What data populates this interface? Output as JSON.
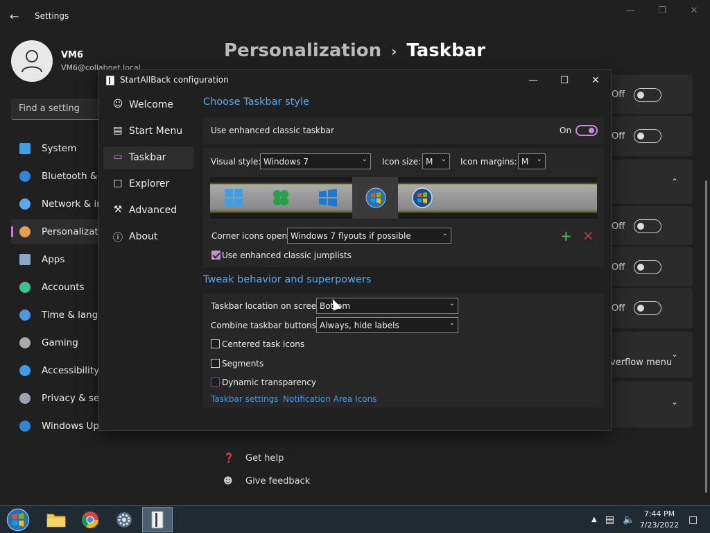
{
  "settings": {
    "window_title": "Settings",
    "user": {
      "name": "VM6",
      "email": "VM6@collabnet.local"
    },
    "search_placeholder": "Find a setting",
    "nav": [
      {
        "label": "System",
        "icon": "monitor-icon"
      },
      {
        "label": "Bluetooth & d",
        "icon": "bluetooth-icon"
      },
      {
        "label": "Network & in",
        "icon": "wifi-icon"
      },
      {
        "label": "Personalizatio",
        "icon": "brush-icon",
        "active": true
      },
      {
        "label": "Apps",
        "icon": "apps-icon"
      },
      {
        "label": "Accounts",
        "icon": "person-icon"
      },
      {
        "label": "Time & langu",
        "icon": "clock-icon"
      },
      {
        "label": "Gaming",
        "icon": "gamepad-icon"
      },
      {
        "label": "Accessibility",
        "icon": "accessibility-icon"
      },
      {
        "label": "Privacy & sec",
        "icon": "shield-icon"
      },
      {
        "label": "Windows Upd",
        "icon": "update-icon"
      }
    ],
    "breadcrumb": {
      "parent": "Personalization",
      "separator": "›",
      "current": "Taskbar"
    },
    "toggles": [
      {
        "label": "Off"
      },
      {
        "label": "Off"
      },
      {
        "label": "Off"
      },
      {
        "label": "Off"
      },
      {
        "label": "Off"
      }
    ],
    "overflow_label": "verflow menu",
    "help": {
      "get_help": "Get help",
      "give_feedback": "Give feedback"
    }
  },
  "dialog": {
    "title": "StartAllBack configuration",
    "nav": [
      {
        "label": "Welcome",
        "icon": "smile-icon"
      },
      {
        "label": "Start Menu",
        "icon": "start-menu-icon"
      },
      {
        "label": "Taskbar",
        "icon": "taskbar-icon",
        "active": true
      },
      {
        "label": "Explorer",
        "icon": "folder-icon"
      },
      {
        "label": "Advanced",
        "icon": "wrench-icon"
      },
      {
        "label": "About",
        "icon": "info-icon"
      }
    ],
    "section1": {
      "heading": "Choose Taskbar style",
      "enhanced_label": "Use enhanced classic taskbar",
      "enhanced_state": "On",
      "visual_style_label": "Visual style:",
      "visual_style_value": "Windows 7",
      "icon_size_label": "Icon size:",
      "icon_size_value": "M",
      "icon_margins_label": "Icon margins:",
      "icon_margins_value": "M",
      "corner_label": "Corner icons open:",
      "corner_value": "Windows 7 flyouts if possible",
      "jumplists_label": "Use enhanced classic jumplists",
      "jumplists_checked": true,
      "plus": "+",
      "remove": "✕"
    },
    "section2": {
      "heading": "Tweak behavior and superpowers",
      "location_label": "Taskbar location on screen:",
      "location_value": "Bottom",
      "combine_label": "Combine taskbar buttons:",
      "combine_value": "Always, hide labels",
      "centered_label": "Centered task icons",
      "segments_label": "Segments",
      "transparency_label": "Dynamic transparency",
      "link_taskbar_settings": "Taskbar settings",
      "link_notification_icons": "Notification Area Icons"
    }
  },
  "taskbar": {
    "time": "7:44 PM",
    "date": "7/23/2022"
  },
  "colors": {
    "accent": "#c88cd6",
    "link": "#4a9ae0",
    "heading_blue": "#60a7e8"
  }
}
